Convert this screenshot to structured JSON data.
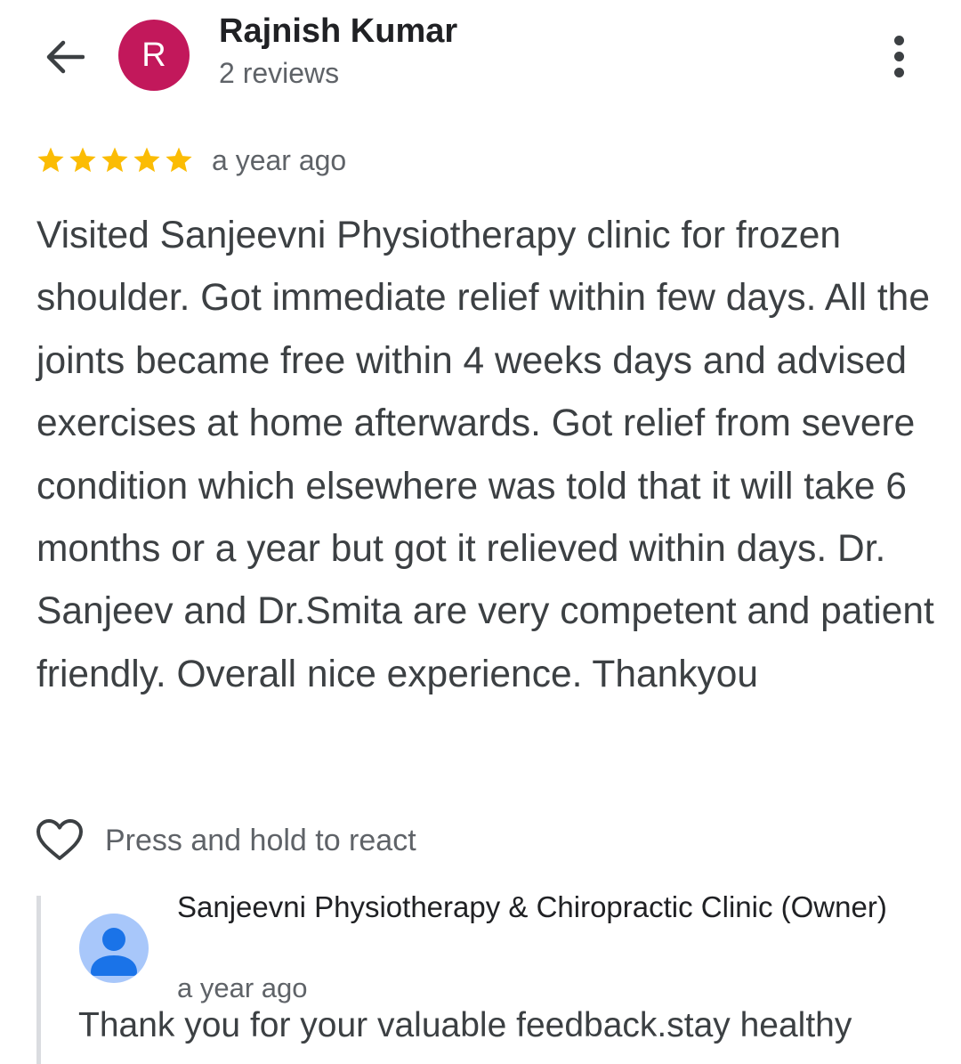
{
  "header": {
    "back_icon": "arrow-back-icon",
    "avatar_letter": "R",
    "avatar_color": "#c2185b",
    "reviewer_name": "Rajnish Kumar",
    "reviewer_meta": "2 reviews",
    "more_icon": "more-vert-icon"
  },
  "review": {
    "rating": 5,
    "rating_max": 5,
    "star_color": "#fbbc04",
    "time": "a year ago",
    "text": "Visited Sanjeevni Physiotherapy clinic for frozen shoulder. Got immediate relief within few days. All the joints became free within 4 weeks days and advised exercises at home afterwards. Got relief from severe condition which elsewhere was told that it will take 6 months or a year but got it relieved within days. Dr. Sanjeev and Dr.Smita are very competent and patient friendly. Overall nice experience. Thankyou"
  },
  "reaction": {
    "icon": "heart-outline-icon",
    "label": "Press and hold to react"
  },
  "owner_response": {
    "avatar_icon": "default-person-icon",
    "name": "Sanjeevni Physiotherapy & Chiropractic Clinic (Owner)",
    "time": "a year ago",
    "text": "Thank you for your valuable feedback.stay healthy"
  }
}
